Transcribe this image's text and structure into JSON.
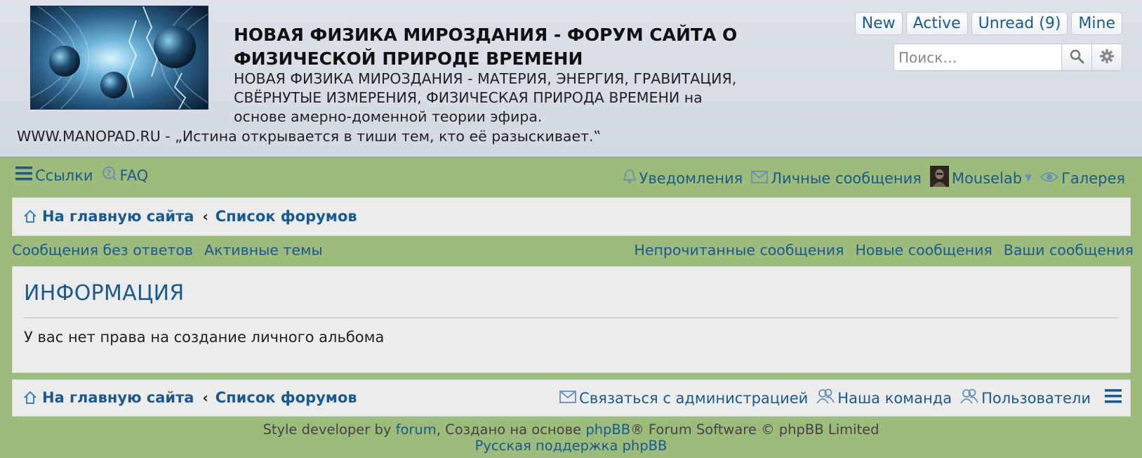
{
  "header": {
    "title": "НОВАЯ ФИЗИКА МИРОЗДАНИЯ - ФОРУМ САЙТА О ФИЗИЧЕСКОЙ ПРИРОДЕ ВРЕМЕНИ",
    "description": "НОВАЯ ФИЗИКА МИРОЗДАНИЯ - МАТЕРИЯ, ЭНЕРГИЯ, ГРАВИТАЦИЯ, СВЁРНУТЫЕ ИЗМЕРЕНИЯ, ФИЗИЧЕСКАЯ ПРИРОДА ВРЕМЕНИ на основе амерно-доменной теории эфира.",
    "motto": "WWW.MANOPAD.RU - „Истина открывается в тиши тем, кто её разыскивает.‟",
    "quick_links": [
      "New",
      "Active",
      "Unread (9)",
      "Mine"
    ],
    "search_placeholder": "Поиск…"
  },
  "nav": {
    "links_label": "Ссылки",
    "faq_label": "FAQ",
    "notifications_label": "Уведомления",
    "messages_label": "Личные сообщения",
    "username": "Mouselab",
    "gallery_label": "Галерея"
  },
  "breadcrumbs": {
    "home": "На главную сайта",
    "forums": "Список форумов"
  },
  "sub_nav": {
    "unanswered": "Сообщения без ответов",
    "active_topics": "Активные темы",
    "unread": "Непрочитанные сообщения",
    "new_posts": "Новые сообщения",
    "your_posts": "Ваши сообщения"
  },
  "info": {
    "title": "ИНФОРМАЦИЯ",
    "message": "У вас нет права на создание личного альбома"
  },
  "footer": {
    "contact": "Связаться с администрацией",
    "team": "Наша команда",
    "members": "Пользователи",
    "style_prefix": "Style developer by",
    "style_link": "forum",
    "created_prefix": ", Создано на основе",
    "phpbb_link": "phpBB",
    "created_suffix": "® Forum Software © phpBB Limited",
    "russian_support": "Русская поддержка phpBB"
  },
  "colors": {
    "link": "#1b5a8c",
    "page_bg": "#9dbb7a",
    "header_bg": "#d6dce5",
    "panel_bg": "#ececec"
  }
}
